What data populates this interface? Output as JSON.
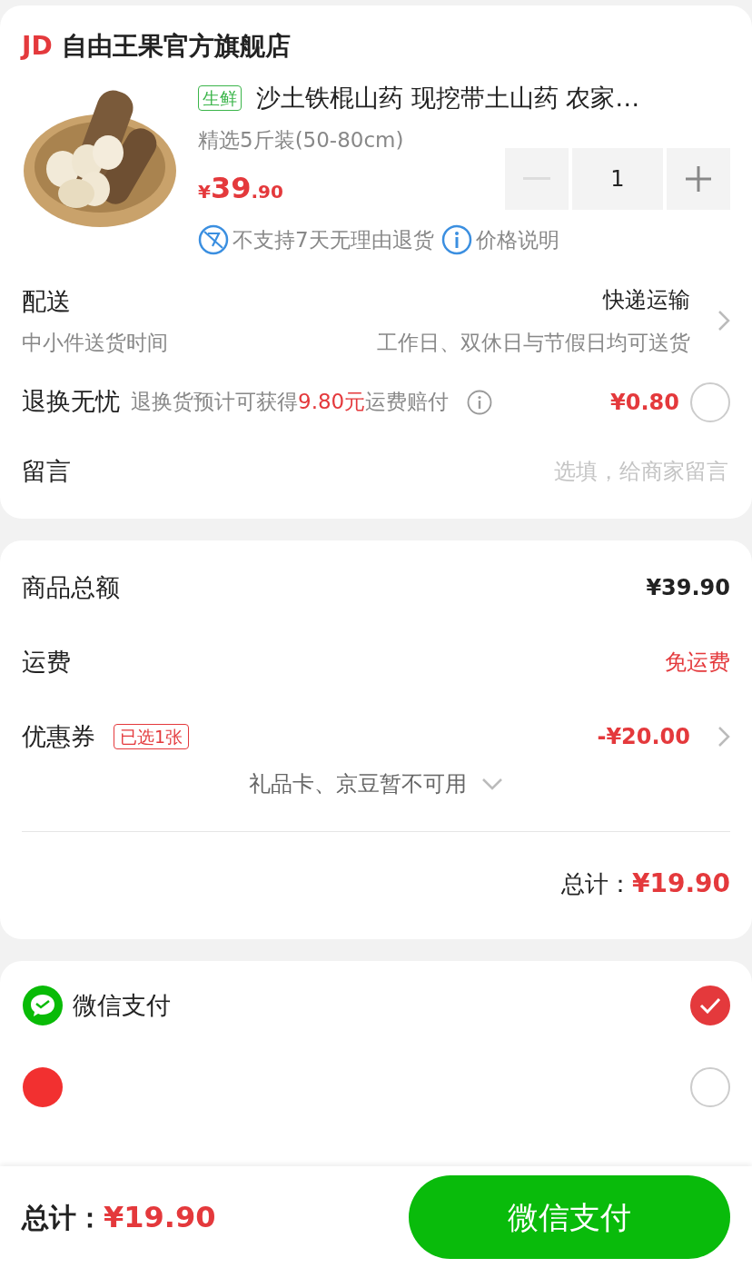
{
  "store": {
    "logo": "JD",
    "name": "自由王果官方旗舰店"
  },
  "product": {
    "kind": "picture",
    "tag": "生鲜",
    "title": "沙土铁棍山药 现挖带土山药 农家…",
    "spec": "精选5斤装(50-80cm)",
    "currency": "¥",
    "price_int": "39",
    "price_dec": ".90",
    "quantity": "1",
    "minus_disabled": true,
    "notes": [
      {
        "kind": "no-return",
        "text": "不支持7天无理由退货"
      },
      {
        "kind": "info",
        "text": "价格说明"
      }
    ]
  },
  "delivery": {
    "label": "配送",
    "method": "快递运输",
    "sub_label": "中小件送货时间",
    "sub_value": "工作日、双休日与节假日均可送货"
  },
  "return_service": {
    "label": "退换无忧",
    "desc_before": "退换货预计可获得",
    "desc_highlight": "9.80元",
    "desc_after": "运费赔付",
    "price": "¥0.80",
    "checked": false
  },
  "message": {
    "label": "留言",
    "placeholder": "选填，给商家留言"
  },
  "summary": [
    {
      "kind": "plain",
      "label": "商品总额",
      "value": "¥39.90"
    },
    {
      "kind": "red",
      "label": "运费",
      "value": "免运费"
    },
    {
      "kind": "coupon",
      "label": "优惠券",
      "tag": "已选1张",
      "value": "-¥20.00"
    }
  ],
  "unavailable": "礼品卡、京豆暂不可用",
  "total": {
    "label": "总计：",
    "value": "¥19.90"
  },
  "payments": [
    {
      "kind": "wechat",
      "name": "微信支付",
      "selected": true
    },
    {
      "kind": "jd",
      "selected": false
    }
  ],
  "footer": {
    "label": "总计：",
    "value": "¥19.90",
    "button": "微信支付"
  }
}
